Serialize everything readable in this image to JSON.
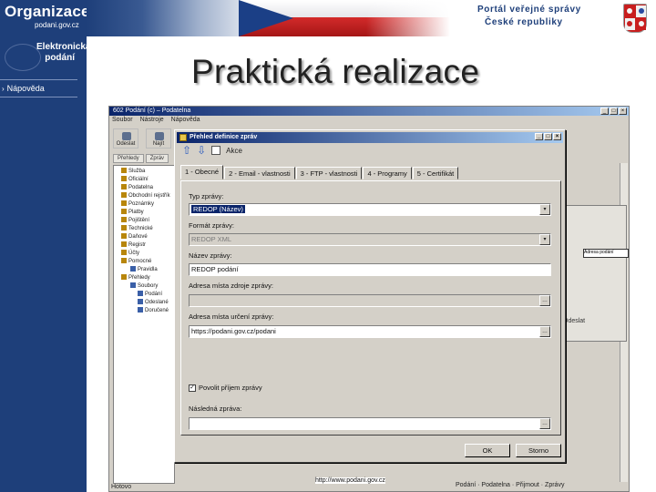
{
  "header": {
    "org_title": "Organizace",
    "org_subtitle": "podani.gov.cz",
    "portal_line1": "Portál veřejné správy",
    "portal_line2": "České republiky"
  },
  "sidebar": {
    "title_line1": "Elektronická",
    "title_line2": "podání",
    "help": "Nápověda"
  },
  "slide": {
    "title": "Praktická realizace",
    "url": "http://www.podani.gov.cz"
  },
  "bg_app": {
    "window_title": "602 Podání (c) – Podatelna",
    "menu": [
      "Soubor",
      "Nástroje",
      "Nápověda"
    ],
    "toolbar": [
      "Odeslat",
      "Najít"
    ],
    "tabs": [
      "Přehledy",
      "Zpráv"
    ],
    "tree": [
      {
        "label": "Služba",
        "level": 0
      },
      {
        "label": "Oficiální",
        "level": 0
      },
      {
        "label": "Podatelna",
        "level": 0
      },
      {
        "label": "Obchodní rejstřík",
        "level": 0
      },
      {
        "label": "Poznámky",
        "level": 0
      },
      {
        "label": "Platby",
        "level": 0
      },
      {
        "label": "Pojištění",
        "level": 0
      },
      {
        "label": "Technické",
        "level": 0
      },
      {
        "label": "Daňové",
        "level": 0
      },
      {
        "label": "Registr",
        "level": 0
      },
      {
        "label": "Účty",
        "level": 0
      },
      {
        "label": "Pomocné",
        "level": 0
      },
      {
        "label": "Pravidla",
        "level": 1
      },
      {
        "label": "Přehledy",
        "level": 0
      },
      {
        "label": "Soubory",
        "level": 1
      },
      {
        "label": "Podání",
        "level": 2
      },
      {
        "label": "Odeslané",
        "level": 2
      },
      {
        "label": "Doručené",
        "level": 2
      }
    ],
    "right_chip": "Adresa podání",
    "right_label": "Odeslat",
    "status_left": "Hotovo",
    "status_right": "Podání · Podatelna · Přijmout · Zprávy"
  },
  "dialog": {
    "title": "Přehled definice zpráv",
    "toolbar_label": "Akce",
    "tabs": [
      "1 - Obecné",
      "2 - Email - vlastnosti",
      "3 - FTP - vlastnosti",
      "4 - Programy",
      "5 - Certifikát"
    ],
    "fields": {
      "name_label": "Typ zprávy:",
      "name_value": "REDOP (Název)",
      "format_label": "Formát zprávy:",
      "format_value": "REDOP XML",
      "subject_label": "Název zprávy:",
      "subject_value": "REDOP podání",
      "source_label": "Adresa místa zdroje zprávy:",
      "source_value": "",
      "target_label": "Adresa místa určení zprávy:",
      "target_value": "https://podani.gov.cz/podani",
      "checkbox_label": "Povolit příjem zprávy",
      "reply_label": "Následná zpráva:",
      "reply_value": ""
    },
    "ok": "OK",
    "cancel": "Storno"
  },
  "colors": {
    "brand_blue": "#1e3f7a",
    "win_titlebar": "#0a246a",
    "win_face": "#d4d0c8"
  }
}
